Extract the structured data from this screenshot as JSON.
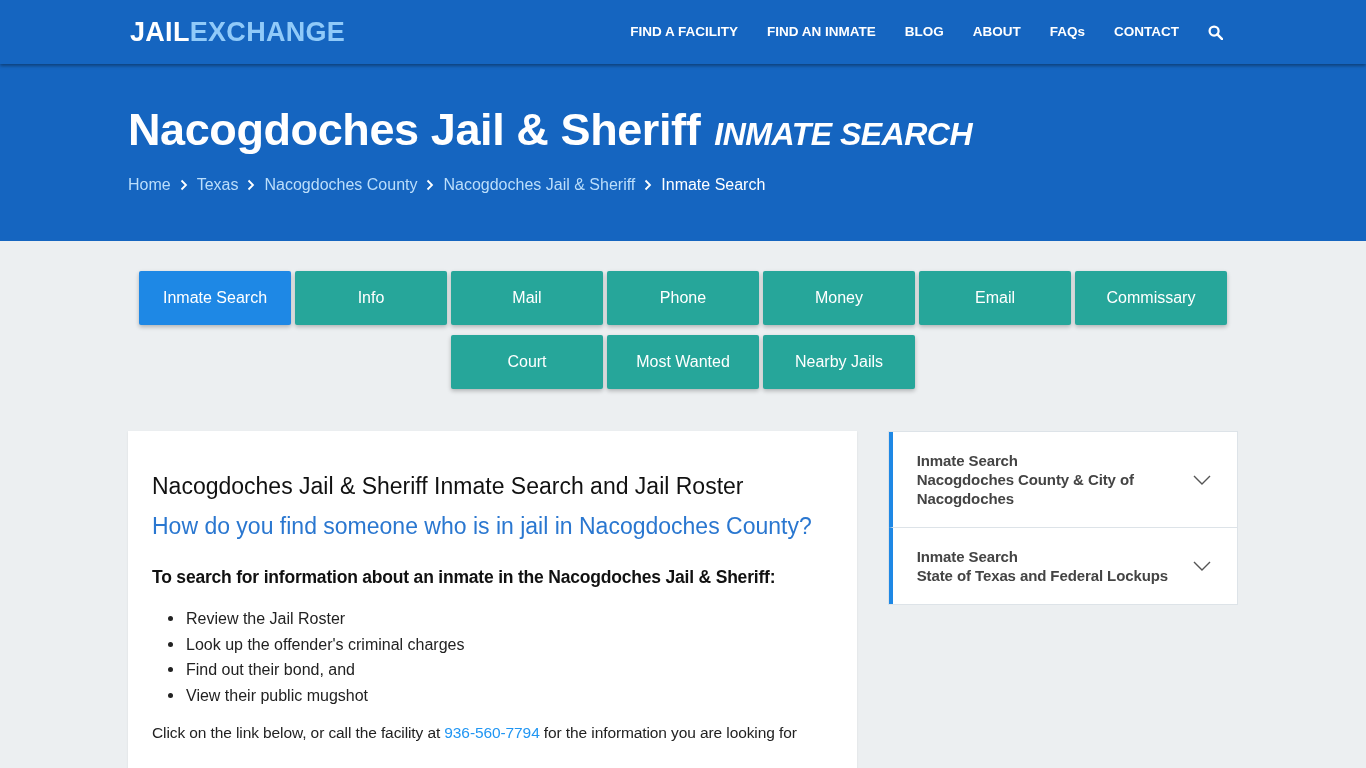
{
  "header": {
    "logo": {
      "primary": "JAIL",
      "secondary": "EXCHANGE"
    },
    "nav": [
      "FIND A FACILITY",
      "FIND AN INMATE",
      "BLOG",
      "ABOUT",
      "FAQs",
      "CONTACT"
    ]
  },
  "hero": {
    "title": "Nacogdoches Jail & Sheriff",
    "subtitle": "INMATE SEARCH",
    "breadcrumbs": [
      {
        "label": "Home",
        "current": false
      },
      {
        "label": "Texas",
        "current": false
      },
      {
        "label": "Nacogdoches County",
        "current": false
      },
      {
        "label": "Nacogdoches Jail & Sheriff",
        "current": false
      },
      {
        "label": "Inmate Search",
        "current": true
      }
    ]
  },
  "tabs": [
    {
      "label": "Inmate Search",
      "selected": true
    },
    {
      "label": "Info",
      "selected": false
    },
    {
      "label": "Mail",
      "selected": false
    },
    {
      "label": "Phone",
      "selected": false
    },
    {
      "label": "Money",
      "selected": false
    },
    {
      "label": "Email",
      "selected": false
    },
    {
      "label": "Commissary",
      "selected": false
    },
    {
      "label": "Court",
      "selected": false
    },
    {
      "label": "Most Wanted",
      "selected": false
    },
    {
      "label": "Nearby Jails",
      "selected": false
    }
  ],
  "article": {
    "title": "Nacogdoches Jail & Sheriff Inmate Search and Jail Roster",
    "question": "How do you find someone who is in jail in Nacogdoches County?",
    "intro": "To search for information about an inmate in the Nacogdoches Jail & Sheriff:",
    "list": [
      "Review the Jail Roster",
      "Look up the offender's criminal charges",
      "Find out their bond, and",
      "View their public mugshot"
    ],
    "paragraph": {
      "before": "Click on the link below, or call the facility at",
      "link": "936-560-7794",
      "after": "for the information you are looking for"
    }
  },
  "sidebar": {
    "items": [
      {
        "title": "Inmate Search",
        "subtitle": "Nacogdoches County & City of Nacogdoches",
        "expanded": false
      },
      {
        "title": "Inmate Search",
        "subtitle": "State of Texas and Federal Lockups",
        "expanded": false
      }
    ]
  }
}
